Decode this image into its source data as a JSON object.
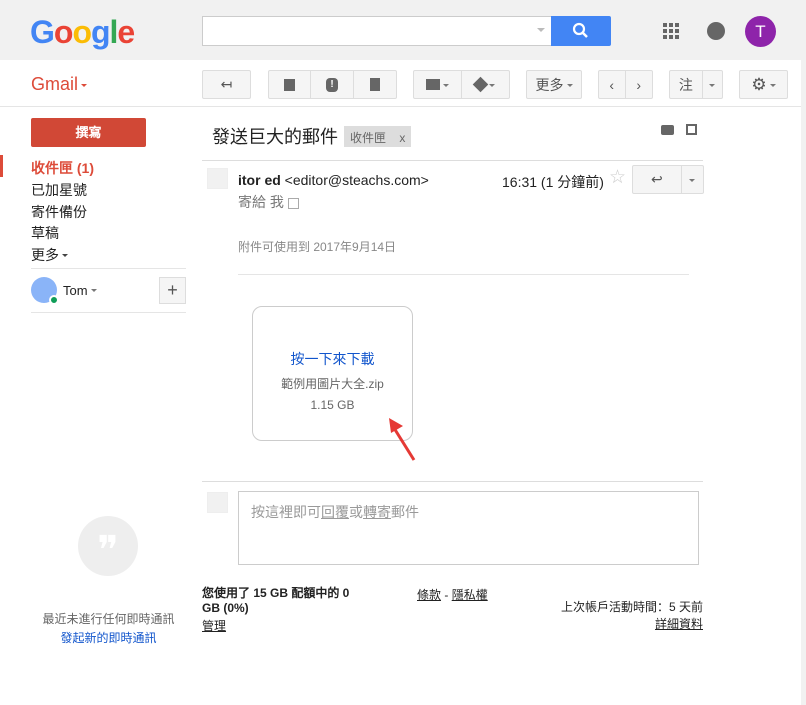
{
  "header": {
    "logo": "Google",
    "search_placeholder": "",
    "avatar_letter": "T"
  },
  "toolbar": {
    "app_label": "Gmail",
    "more_label": "更多",
    "note_label": "注"
  },
  "sidebar": {
    "compose": "撰寫",
    "items": [
      {
        "label": "收件匣 (1)"
      },
      {
        "label": "已加星號"
      },
      {
        "label": "寄件備份"
      },
      {
        "label": "草稿"
      },
      {
        "label": "更多"
      }
    ],
    "user": "Tom",
    "chat_empty": "最近未進行任何即時通訊",
    "chat_start": "發起新的即時通訊"
  },
  "message": {
    "subject": "發送巨大的郵件",
    "label": "收件匣",
    "label_close": "x",
    "sender_name": "itor ed",
    "sender_email": "<editor@steachs.com>",
    "time": "16:31 (1 分鐘前)",
    "to_label": "寄給",
    "to": "我",
    "expiry": "附件可使用到 2017年9月14日",
    "attachment": {
      "download": "按一下來下載",
      "filename": "範例用圖片大全.zip",
      "size": "1.15 GB"
    }
  },
  "reply": {
    "pre": "按這裡即可",
    "reply": "回覆",
    "or": "或",
    "forward": "轉寄",
    "post": "郵件"
  },
  "footer": {
    "quota": "您使用了 15 GB 配額中的 0 GB (0%)",
    "manage": "管理",
    "terms": "條款",
    "sep": " - ",
    "privacy": "隱私權",
    "activity": "上次帳戶活動時間：5 天前",
    "details": "詳細資料"
  }
}
